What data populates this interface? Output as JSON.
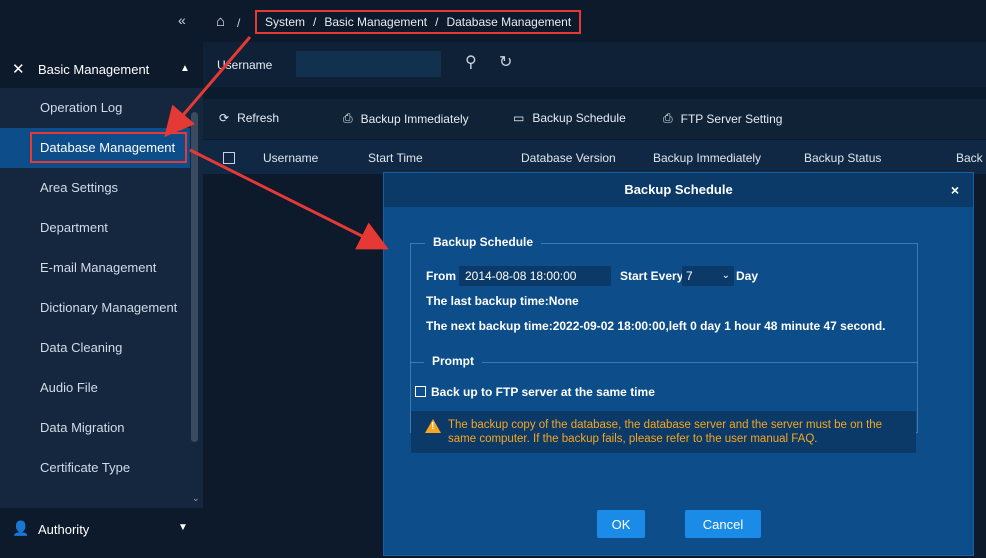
{
  "sidebar": {
    "collapse_icon": "double-chevron-left-icon",
    "basic_section": {
      "icon": "tools-icon",
      "label": "Basic Management",
      "chev": "▲"
    },
    "items": [
      {
        "label": "Operation Log"
      },
      {
        "label": "Database Management"
      },
      {
        "label": "Area Settings"
      },
      {
        "label": "Department"
      },
      {
        "label": "E-mail Management"
      },
      {
        "label": "Dictionary Management"
      },
      {
        "label": "Data Cleaning"
      },
      {
        "label": "Audio File"
      },
      {
        "label": "Data Migration"
      },
      {
        "label": "Certificate Type"
      }
    ],
    "active_index": 1,
    "auth_section": {
      "icon": "user-gear-icon",
      "label": "Authority",
      "chev": "▼"
    }
  },
  "topbar": {
    "home_icon": "home-icon",
    "breadcrumb": [
      "System",
      "Basic Management",
      "Database Management"
    ],
    "sep": "/"
  },
  "filter": {
    "username_label": "Username",
    "username_value": "",
    "search_icon": "search-icon",
    "reset_icon": "refresh-icon"
  },
  "toolbar": {
    "refresh": "Refresh",
    "backup_now": "Backup Immediately",
    "backup_schedule": "Backup Schedule",
    "ftp": "FTP Server Setting"
  },
  "table": {
    "headers": [
      "Username",
      "Start Time",
      "Database Version",
      "Backup Immediately",
      "Backup Status",
      "Back"
    ]
  },
  "modal": {
    "title": "Backup Schedule",
    "close": "×",
    "schedule_legend": "Backup Schedule",
    "from_label": "From",
    "from_value": "2014-08-08 18:00:00",
    "start_every_label": "Start Every",
    "every_value": "7",
    "day_label": "Day",
    "last_backup": "The last backup time:None",
    "next_backup": "The next backup time:2022-09-02 18:00:00,left 0 day 1 hour 48 minute 47 second.",
    "prompt_legend": "Prompt",
    "ftp_checkbox": "Back up to FTP server at the same time",
    "ftp_checked": false,
    "warning_icon": "warning-icon",
    "warning_text": "The backup copy of the database, the database server and the server must be on the same computer. If the backup fails, please refer to the user manual FAQ.",
    "ok": "OK",
    "cancel": "Cancel"
  },
  "colors": {
    "sidebar_bg": "#14273f",
    "active_bg": "#0d4d8a",
    "modal_bg": "#0d4d8a",
    "button_blue": "#1a8ce8",
    "warning": "#f5a623",
    "annotation_red": "#e53935"
  }
}
